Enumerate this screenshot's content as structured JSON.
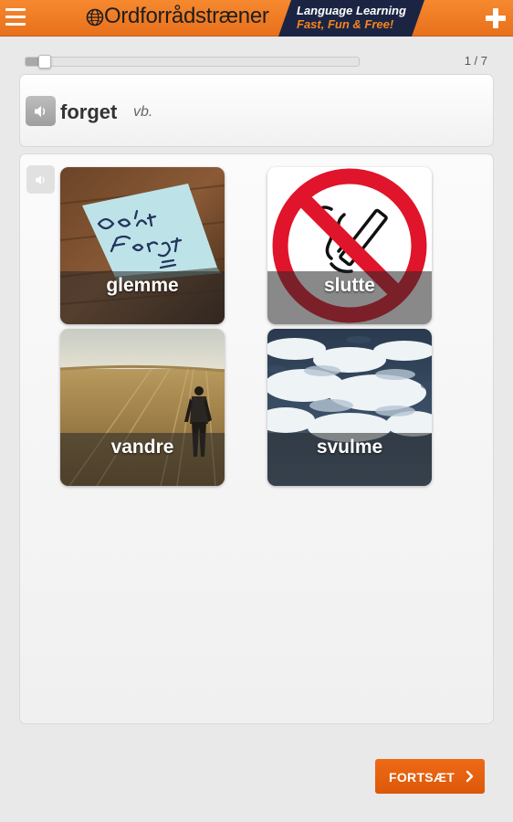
{
  "header": {
    "brand": "Ordforrådstræner",
    "tagline_line1": "Language Learning",
    "tagline_line2": "Fast, Fun & Free!",
    "icons": {
      "menu": "hamburger-menu-icon",
      "add": "plus-icon",
      "logo": "globe-icon"
    },
    "colors": {
      "bar": "#f07d22",
      "tagline_bg": "#1b2543",
      "tagline_accent": "#f7841f"
    }
  },
  "progress": {
    "current": 1,
    "total": 7,
    "label": "1 / 7",
    "fraction": 0.143
  },
  "word": {
    "text": "forget",
    "pos": "vb.",
    "audio_icon": "speaker-icon"
  },
  "choices": [
    {
      "label": "glemme",
      "image": "dont-forget-sticky-note"
    },
    {
      "label": "slutte",
      "image": "no-smoking-sign"
    },
    {
      "label": "vandre",
      "image": "man-walking-in-field"
    },
    {
      "label": "svulme",
      "image": "sea-foam-waves"
    }
  ],
  "continue_button": {
    "label": "FORTSÆT",
    "icon": "chevron-right-icon",
    "color": "#e55e0e"
  }
}
